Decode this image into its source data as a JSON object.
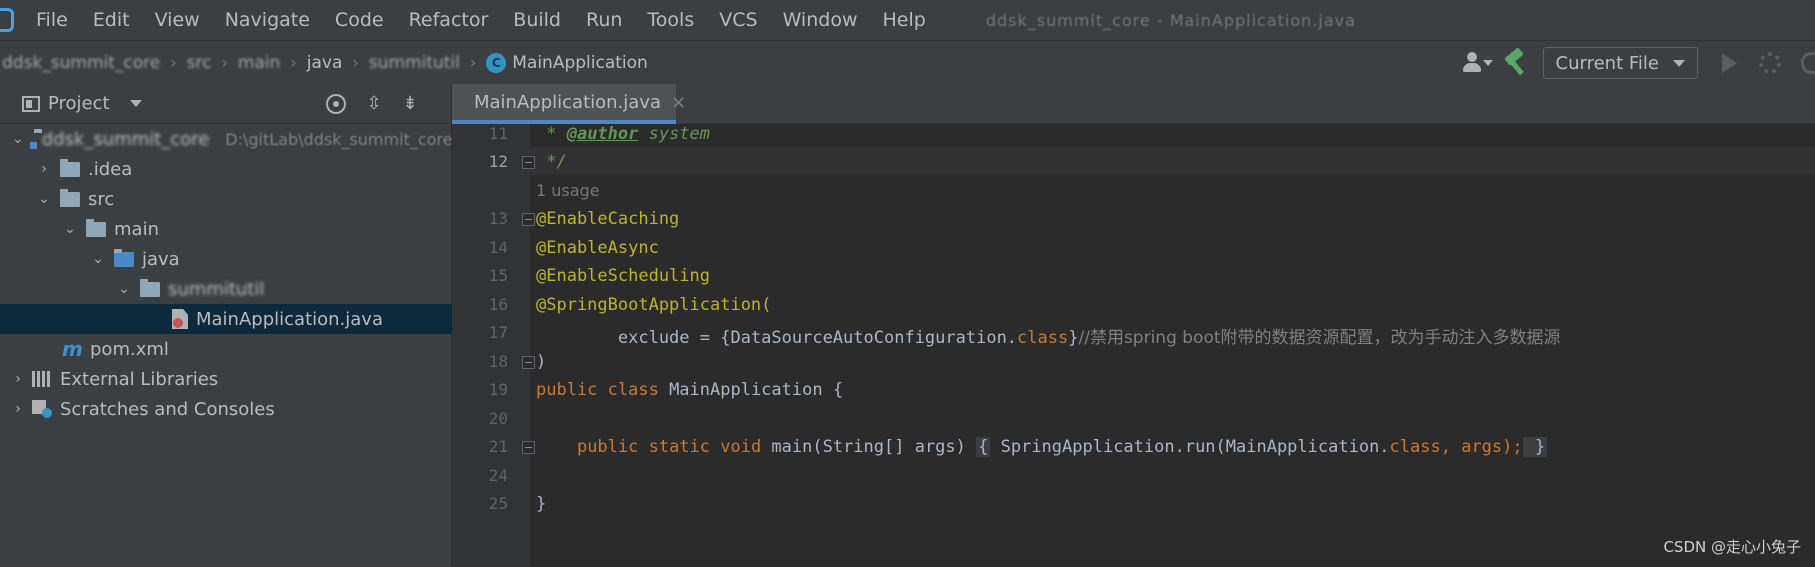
{
  "menubar": {
    "items": [
      "File",
      "Edit",
      "View",
      "Navigate",
      "Code",
      "Refactor",
      "Build",
      "Run",
      "Tools",
      "VCS",
      "Window",
      "Help"
    ],
    "window_title": "ddsk_summit_core - MainApplication.java"
  },
  "navbar": {
    "crumbs": [
      "ddsk_summit_core",
      "src",
      "main",
      "java",
      "summitutil"
    ],
    "current": "MainApplication",
    "run_config": "Current File"
  },
  "project": {
    "title": "Project",
    "tree": {
      "root_label": "ddsk_summit_core",
      "root_path": "D:\\gitLab\\ddsk_summit_core\\dd",
      "idea": ".idea",
      "src": "src",
      "main": "main",
      "java": "java",
      "package": "summitutil",
      "main_class": "MainApplication.java",
      "pom": "pom.xml",
      "external_libraries": "External Libraries",
      "scratches": "Scratches and Consoles"
    }
  },
  "editor": {
    "tab_label": "MainApplication.java",
    "line_numbers": [
      "11",
      "12",
      "13",
      "14",
      "15",
      "16",
      "17",
      "18",
      "19",
      "20",
      "21",
      "24",
      "25"
    ],
    "usage_hint": "1 usage",
    "code": {
      "l11_prefix": " * ",
      "l11_tag": "@author",
      "l11_rest": " system",
      "l12": " */",
      "l13": "@EnableCaching",
      "l14": "@EnableAsync",
      "l15": "@EnableScheduling",
      "l16": "@SpringBootApplication(",
      "l17_a": "        exclude = {DataSourceAutoConfiguration.",
      "l17_kw": "class",
      "l17_b": "}",
      "l17_comment": "//禁用spring boot附带的数据资源配置，改为手动注入多数据源",
      "l18": ")",
      "l19_kw": "public class ",
      "l19_rest": "MainApplication {",
      "l21_indent": "    ",
      "l21_kw": "public static void ",
      "l21_a": "main(String[] args) ",
      "l21_brace_open": "{",
      "l21_b": " SpringApplication.run(MainApplication.",
      "l21_kw2": "class",
      "l21_c": ", args)",
      "l21_semi": ";",
      "l21_brace_close": " }",
      "l25": "}"
    }
  },
  "watermark": "CSDN @走心小兔子",
  "colors": {
    "keyword": "#cc7832",
    "comment": "#629755",
    "default_text": "#a9b7c6",
    "selection": "#0d293e",
    "tab_underline": "#4a88c7"
  }
}
